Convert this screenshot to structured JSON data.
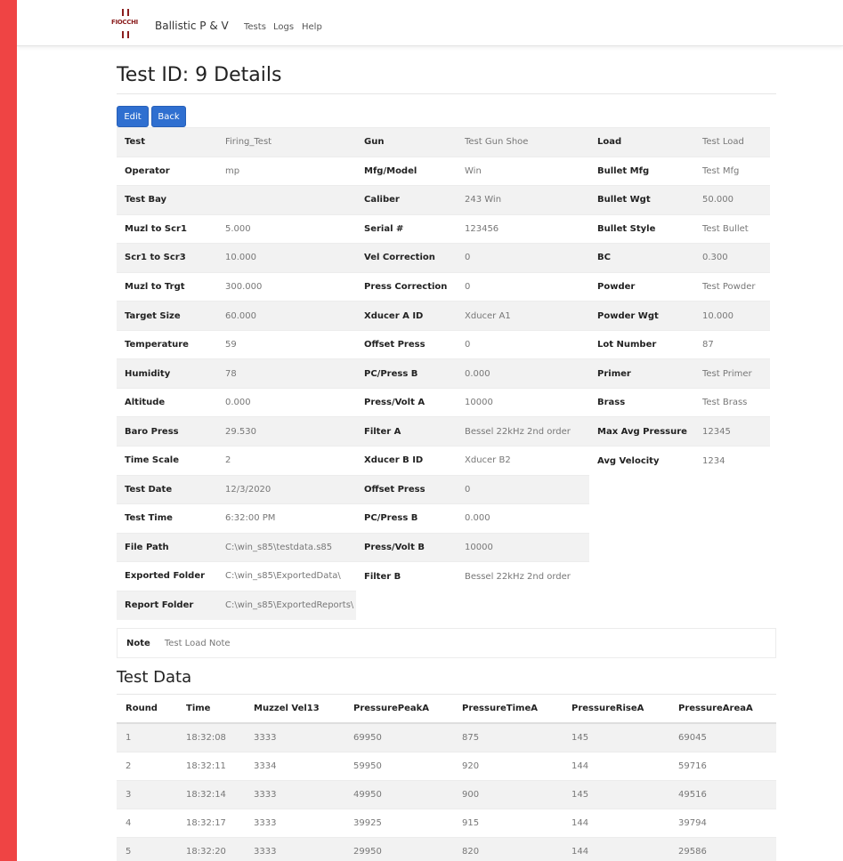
{
  "navbar": {
    "logo_text": "FIOCCHI",
    "brand": "Ballistic P & V",
    "links": [
      "Tests",
      "Logs",
      "Help"
    ]
  },
  "title": "Test ID: 9 Details",
  "buttons": {
    "edit": "Edit",
    "back": "Back"
  },
  "details": [
    [
      "Test",
      "Firing_Test",
      "Gun",
      "Test Gun Shoe",
      "Load",
      "Test Load"
    ],
    [
      "Operator",
      "mp",
      "Mfg/Model",
      "Win",
      "Bullet Mfg",
      "Test Mfg"
    ],
    [
      "Test Bay",
      "",
      "Caliber",
      "243 Win",
      "Bullet Wgt",
      "50.000"
    ],
    [
      "Muzl to Scr1",
      "5.000",
      "Serial #",
      "123456",
      "Bullet Style",
      "Test Bullet"
    ],
    [
      "Scr1 to Scr3",
      "10.000",
      "Vel Correction",
      "0",
      "BC",
      "0.300"
    ],
    [
      "Muzl to Trgt",
      "300.000",
      "Press Correction",
      "0",
      "Powder",
      "Test Powder"
    ],
    [
      "Target Size",
      "60.000",
      "Xducer A ID",
      "Xducer A1",
      "Powder Wgt",
      "10.000"
    ],
    [
      "Temperature",
      "59",
      "Offset Press",
      "0",
      "Lot Number",
      "87"
    ],
    [
      "Humidity",
      "78",
      "PC/Press B",
      "0.000",
      "Primer",
      "Test Primer"
    ],
    [
      "Altitude",
      "0.000",
      "Press/Volt A",
      "10000",
      "Brass",
      "Test Brass"
    ],
    [
      "Baro Press",
      "29.530",
      "Filter A",
      "Bessel 22kHz 2nd order",
      "Max Avg Pressure",
      "12345"
    ],
    [
      "Time Scale",
      "2",
      "Xducer B ID",
      "Xducer B2",
      "Avg Velocity",
      "1234"
    ],
    [
      "Test Date",
      "12/3/2020",
      "Offset Press",
      "0"
    ],
    [
      "Test Time",
      "6:32:00 PM",
      "PC/Press B",
      "0.000"
    ],
    [
      "File Path",
      "C:\\win_s85\\testdata.s85",
      "Press/Volt B",
      "10000"
    ],
    [
      "Exported Folder",
      "C:\\win_s85\\ExportedData\\",
      "Filter B",
      "Bessel 22kHz 2nd order"
    ],
    [
      "Report Folder",
      "C:\\win_s85\\ExportedReports\\"
    ]
  ],
  "note": {
    "label": "Note",
    "value": "Test Load Note"
  },
  "test_data": {
    "title": "Test Data",
    "columns": [
      "Round",
      "Time",
      "Muzzel Vel13",
      "PressurePeakA",
      "PressureTimeA",
      "PressureRiseA",
      "PressureAreaA"
    ],
    "rows": [
      [
        "1",
        "18:32:08",
        "3333",
        "69950",
        "875",
        "145",
        "69045"
      ],
      [
        "2",
        "18:32:11",
        "3334",
        "59950",
        "920",
        "144",
        "59716"
      ],
      [
        "3",
        "18:32:14",
        "3333",
        "49950",
        "900",
        "145",
        "49516"
      ],
      [
        "4",
        "18:32:17",
        "3333",
        "39925",
        "915",
        "144",
        "39794"
      ],
      [
        "5",
        "18:32:20",
        "3333",
        "29950",
        "820",
        "144",
        "29586"
      ]
    ]
  }
}
